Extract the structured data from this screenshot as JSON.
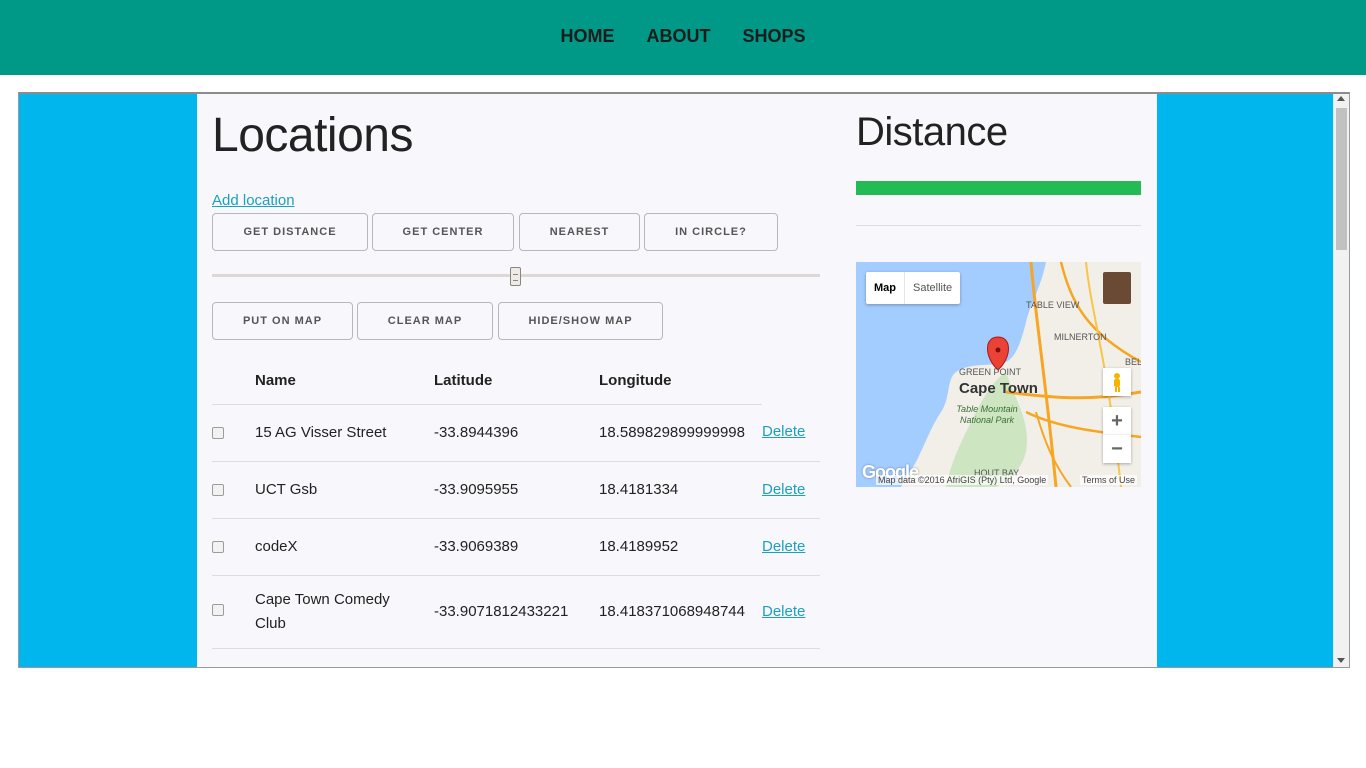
{
  "nav": {
    "items": [
      {
        "label": "HOME"
      },
      {
        "label": "ABOUT"
      },
      {
        "label": "SHOPS"
      }
    ]
  },
  "locations": {
    "title": "Locations",
    "add_link": "Add location",
    "buttons_row1": [
      {
        "label": "GET DISTANCE"
      },
      {
        "label": "GET CENTER"
      },
      {
        "label": "NEAREST"
      },
      {
        "label": "IN CIRCLE?"
      }
    ],
    "buttons_row2": [
      {
        "label": "PUT ON MAP"
      },
      {
        "label": "CLEAR MAP"
      },
      {
        "label": "HIDE/SHOW MAP"
      }
    ],
    "slider_value": 0.5,
    "table": {
      "headers": {
        "name": "Name",
        "latitude": "Latitude",
        "longitude": "Longitude"
      },
      "delete_label": "Delete",
      "rows": [
        {
          "name": "15 AG Visser Street",
          "latitude": "-33.8944396",
          "longitude": "18.589829899999998"
        },
        {
          "name": "UCT Gsb",
          "latitude": "-33.9095955",
          "longitude": "18.4181334"
        },
        {
          "name": "codeX",
          "latitude": "-33.9069389",
          "longitude": "18.4189952"
        },
        {
          "name": "Cape Town Comedy Club",
          "latitude": "-33.9071812433221",
          "longitude": "18.418371068948744"
        }
      ]
    }
  },
  "distance": {
    "title": "Distance",
    "progress_fraction": 1.0,
    "progress_color": "#22bb55"
  },
  "map": {
    "type_map": "Map",
    "type_satellite": "Satellite",
    "city_label": "Cape Town",
    "labels": {
      "table_view": "TABLE VIEW",
      "milnerton": "MILNERTON",
      "green_point": "GREEN POINT",
      "table_mountain": "Table Mountain National Park",
      "bel": "BEL",
      "hout_bay": "HOUT BAY"
    },
    "zoom_in": "+",
    "zoom_out": "−",
    "attribution": "Map data ©2016 AfriGIS (Pty) Ltd, Google",
    "terms": "Terms of Use",
    "logo": "Google"
  },
  "colors": {
    "header_bg": "#009886",
    "frame_bg": "#00b6ec",
    "panel_bg": "#f8f8fc",
    "link": "#1ba0be"
  }
}
